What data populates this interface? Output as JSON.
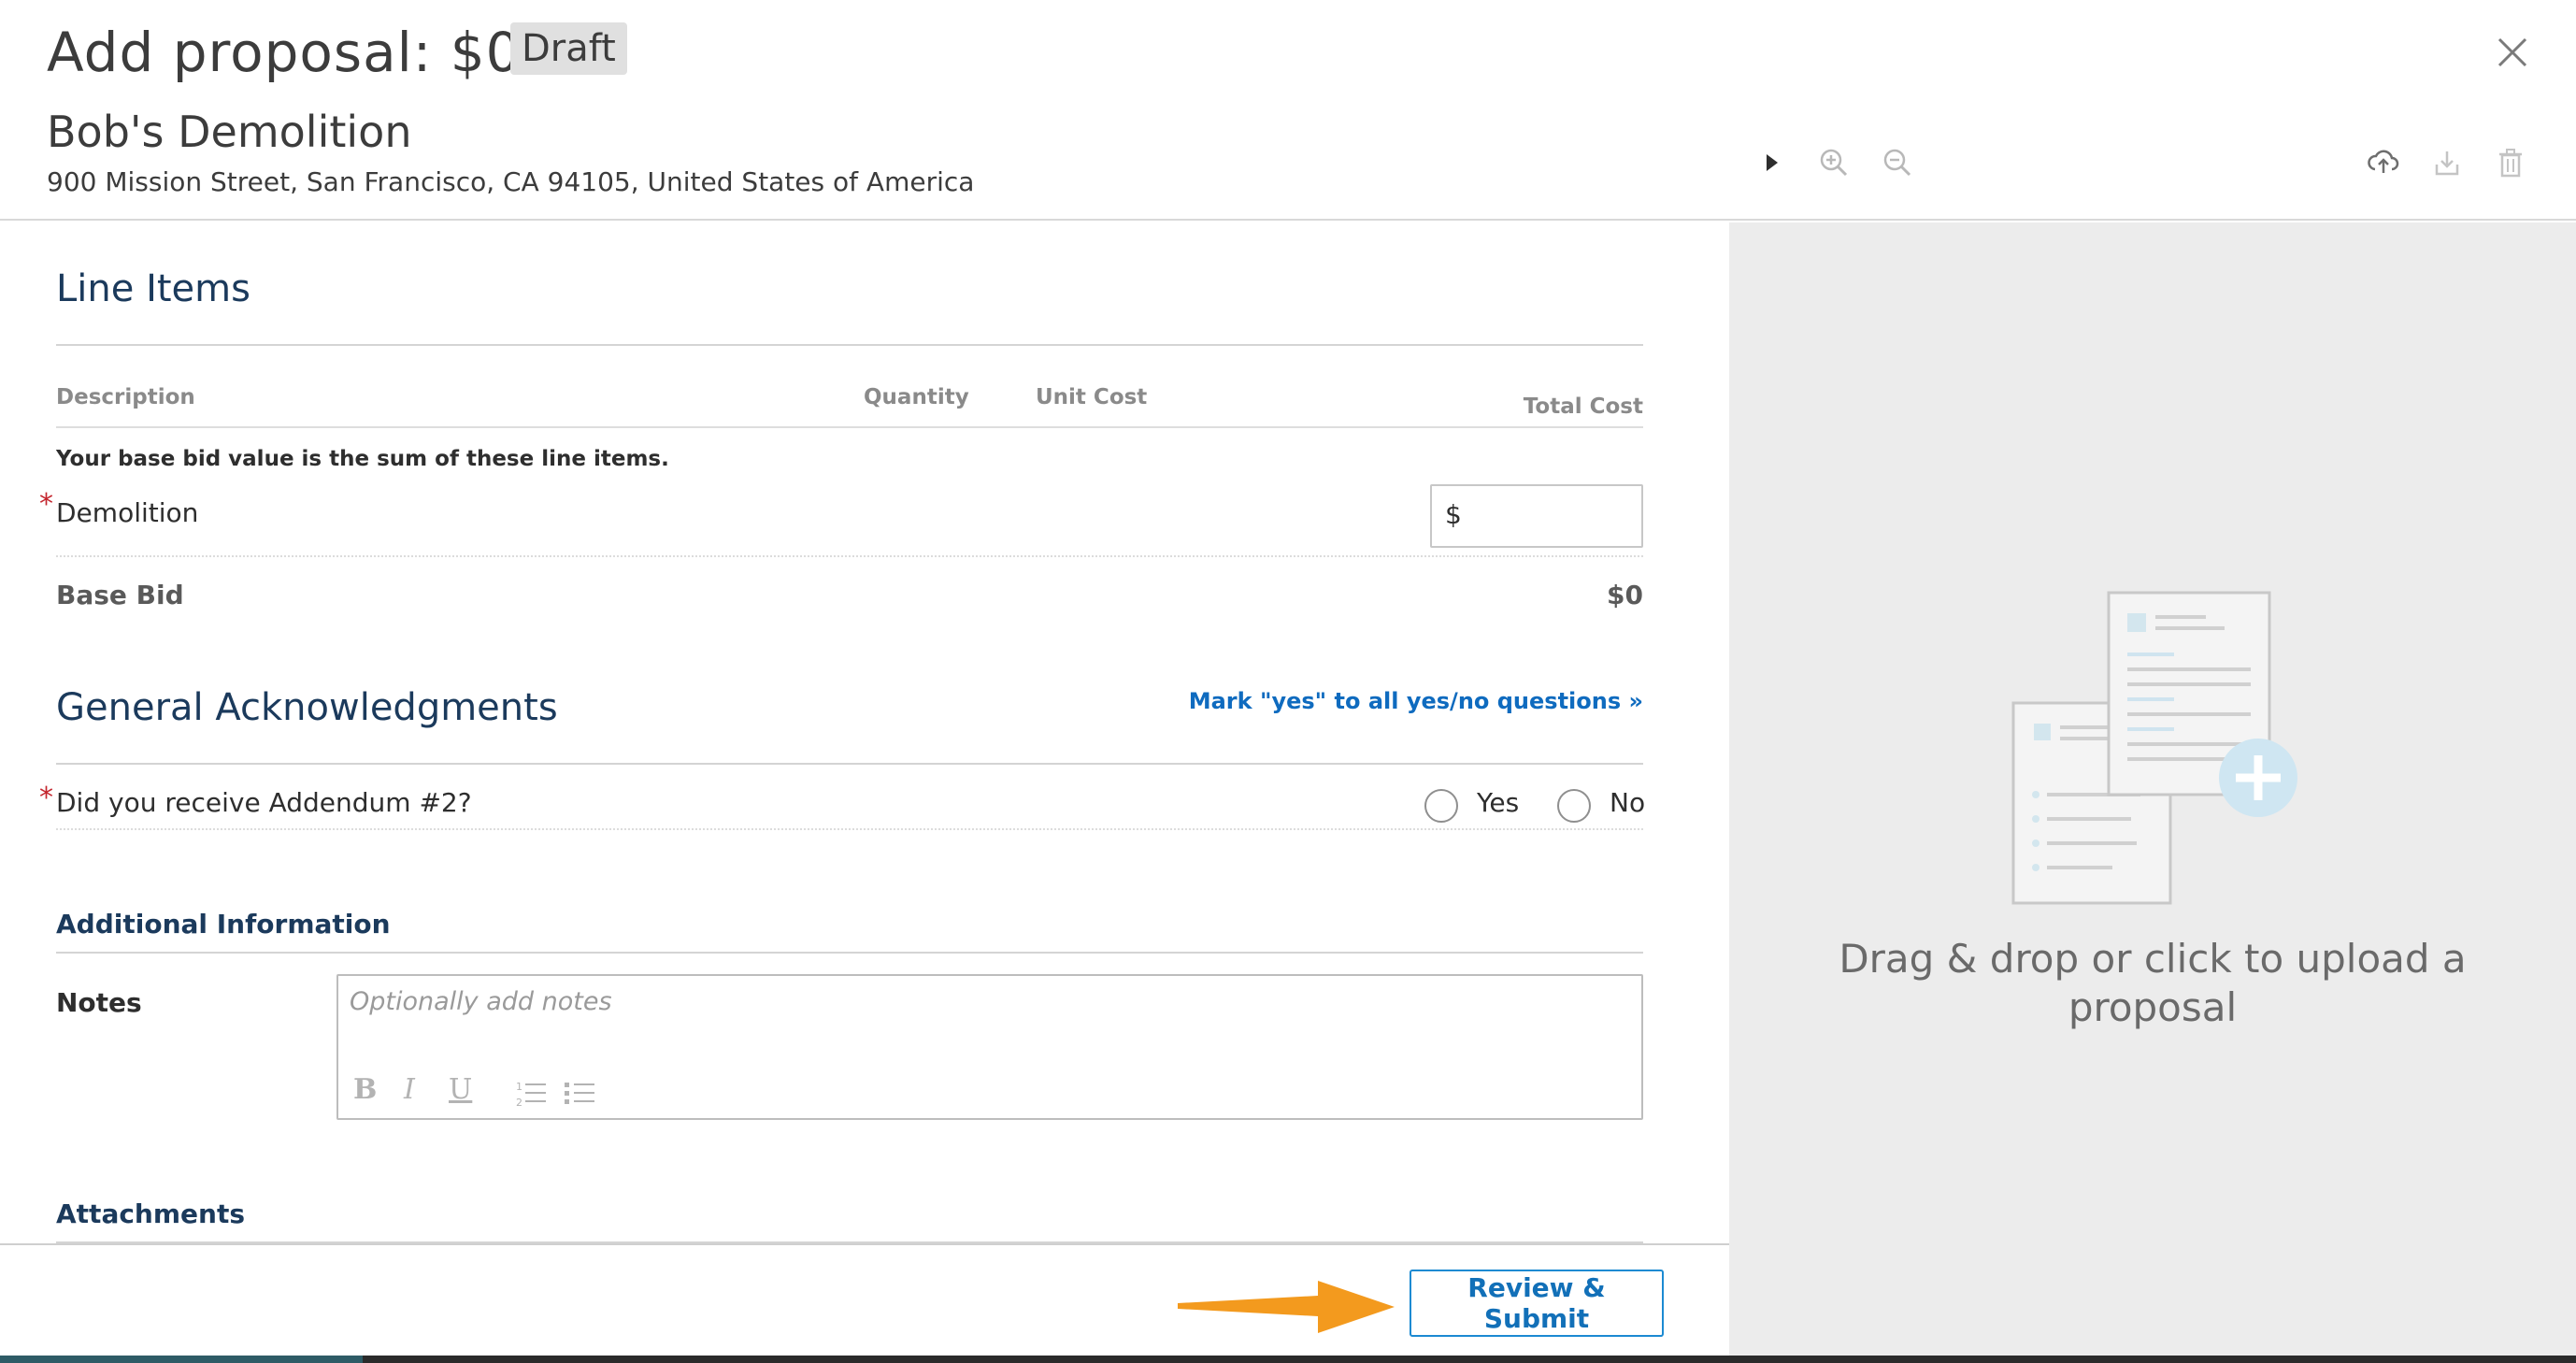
{
  "header": {
    "title": "Add proposal: $0",
    "status_badge": "Draft",
    "vendor_name": "Bob's Demolition",
    "address": "900 Mission Street, San Francisco, CA 94105, United States of America",
    "icons": [
      "close-icon",
      "play-icon",
      "zoom-in-icon",
      "zoom-out-icon",
      "upload-icon",
      "download-icon",
      "trash-icon"
    ]
  },
  "line_items": {
    "title": "Line Items",
    "columns": {
      "description": "Description",
      "quantity": "Quantity",
      "unit_cost": "Unit Cost",
      "total_cost": "Total Cost"
    },
    "help_text": "Your base bid value is the sum of these line items.",
    "rows": [
      {
        "label": "Demolition",
        "required": "*",
        "input_placeholder": "$"
      }
    ],
    "base_bid_label": "Base Bid",
    "base_bid_value": "$0"
  },
  "acknowledgments": {
    "title": "General Acknowledgments",
    "mark_all_link": "Mark \"yes\" to all yes/no questions »",
    "questions": [
      {
        "label": "Did you receive Addendum #2?",
        "required": "*",
        "yes": "Yes",
        "no": "No"
      }
    ]
  },
  "additional_info": {
    "title": "Additional Information",
    "notes_label": "Notes",
    "notes_placeholder": "Optionally add notes",
    "toolbar": [
      "B",
      "I",
      "U"
    ]
  },
  "attachments": {
    "title": "Attachments"
  },
  "footer": {
    "submit_label": "Review & Submit"
  },
  "upload_panel": {
    "text": "Drag & drop or click to upload a proposal"
  },
  "colors": {
    "accent_blue": "#1c8ad2",
    "heading_navy": "#1b3a5c",
    "arrow_orange": "#f39a1e",
    "required_red": "#c4262e"
  }
}
